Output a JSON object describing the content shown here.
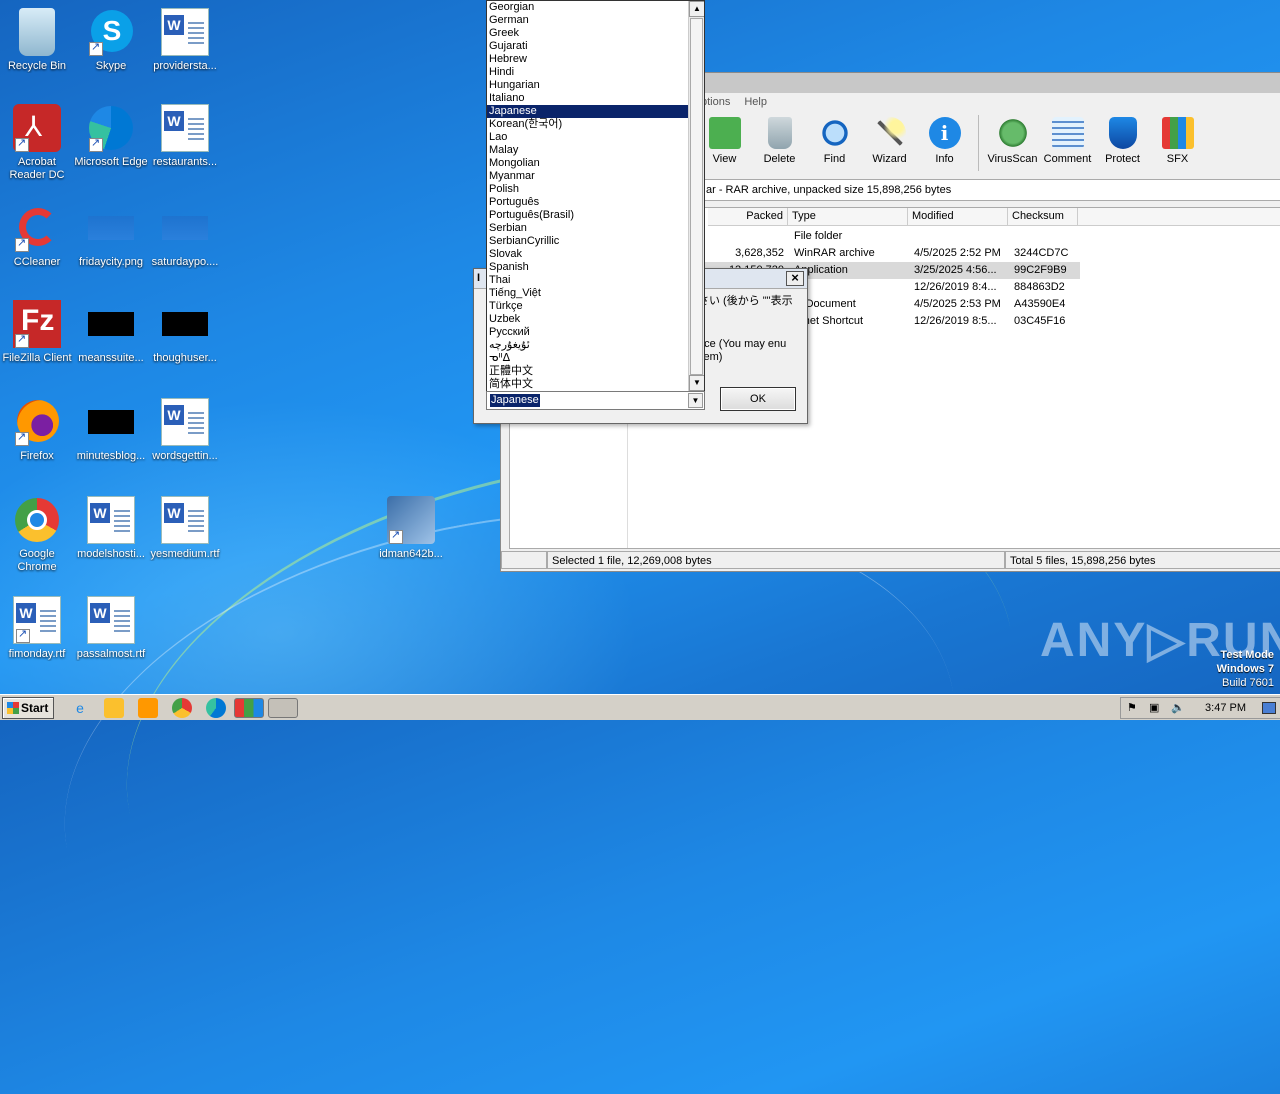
{
  "desktop": {
    "icons": [
      {
        "label": "Recycle Bin"
      },
      {
        "label": "Skype"
      },
      {
        "label": "providersta..."
      },
      {
        "label": "Acrobat Reader DC"
      },
      {
        "label": "Microsoft Edge"
      },
      {
        "label": "restaurants..."
      },
      {
        "label": "CCleaner"
      },
      {
        "label": "fridaycity.png"
      },
      {
        "label": "saturdaypo...."
      },
      {
        "label": "FileZilla Client"
      },
      {
        "label": "meanssuite..."
      },
      {
        "label": "thoughuser..."
      },
      {
        "label": "Firefox"
      },
      {
        "label": "minutesblog..."
      },
      {
        "label": "wordsgettin..."
      },
      {
        "label": "Google Chrome"
      },
      {
        "label": "modelshosti..."
      },
      {
        "label": "yesmedium.rtf"
      },
      {
        "label": "fimonday.rtf"
      },
      {
        "label": "passalmost.rtf"
      },
      {
        "label": "idman642b..."
      }
    ]
  },
  "winrar": {
    "menu": [
      "ptions",
      "Help"
    ],
    "toolbar": [
      "View",
      "Delete",
      "Find",
      "Wizard",
      "Info",
      "VirusScan",
      "Comment",
      "Protect",
      "SFX"
    ],
    "path_text": "ar - RAR archive, unpacked size 15,898,256 bytes",
    "columns": [
      "Packed",
      "Type",
      "Modified",
      "Checksum"
    ],
    "rows": [
      {
        "packed": "",
        "type": "File folder",
        "modified": "",
        "checksum": ""
      },
      {
        "packed": "3,628,352",
        "type": "WinRAR archive",
        "modified": "4/5/2025 2:52 PM",
        "checksum": "3244CD7C"
      },
      {
        "packed": "12,150,720",
        "type": "Application",
        "modified": "3/25/2025 4:56...",
        "checksum": "99C2F9B9"
      },
      {
        "packed": "",
        "type": "",
        "modified": "12/26/2019 8:4...",
        "checksum": "884863D2"
      },
      {
        "packed": "",
        "type": "xt Document",
        "modified": "4/5/2025 2:53 PM",
        "checksum": "A43590E4"
      },
      {
        "packed": "",
        "type": "ernet Shortcut",
        "modified": "12/26/2019 8:5...",
        "checksum": "03C45F16"
      }
    ],
    "status_left": "Selected 1 file, 12,269,008 bytes",
    "status_right": "Total 5 files, 15,898,256 bytes"
  },
  "dialog": {
    "title_fragment": "I",
    "text_jp": "さい (後から \"\"表示",
    "text_note": "ace (You may enu item)",
    "ok_label": "OK",
    "selected_value": "Japanese"
  },
  "languages": [
    "Georgian",
    "German",
    "Greek",
    "Gujarati",
    "Hebrew",
    "Hindi",
    "Hungarian",
    "Italiano",
    "Japanese",
    "Korean(한국어)",
    "Lao",
    "Malay",
    "Mongolian",
    "Myanmar",
    "Polish",
    "Português",
    "Português(Brasil)",
    "Serbian",
    "SerbianCyrillic",
    "Slovak",
    "Spanish",
    "Thai",
    "Tiếng_Việt",
    "Türkçe",
    "Uzbek",
    "Русский",
    "ئۇيغۇرچە",
    "ᓀᐦᐃ",
    "正體中文",
    "简体中文"
  ],
  "watermark": {
    "brand": "ANY▷RUN",
    "line1": "Test Mode",
    "line2": "Windows 7",
    "line3": "Build 7601"
  },
  "taskbar": {
    "start_label": "Start",
    "clock": "3:47 PM"
  }
}
